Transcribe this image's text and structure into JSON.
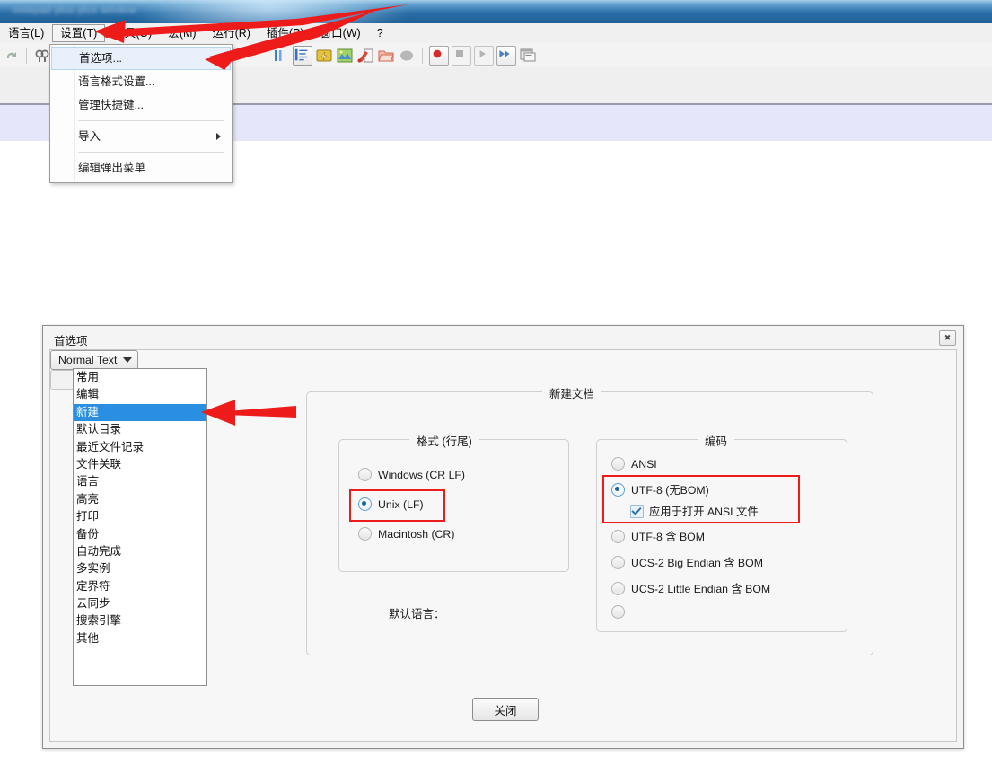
{
  "window": {
    "title_blurred": "notepad plus plus window"
  },
  "menubar": {
    "items": [
      {
        "label": "语言(L)",
        "active": false
      },
      {
        "label": "设置(T)",
        "active": true
      },
      {
        "label": "工具(O)",
        "active": false
      },
      {
        "label": "宏(M)",
        "active": false
      },
      {
        "label": "运行(R)",
        "active": false
      },
      {
        "label": "插件(P)",
        "active": false
      },
      {
        "label": "窗口(W)",
        "active": false
      },
      {
        "label": "?",
        "active": false
      }
    ]
  },
  "toolbar": {
    "icons": [
      {
        "name": "redo-icon",
        "color": "#a9b5ad"
      },
      {
        "name": "find-replace-icon",
        "color": "#8a8a8a"
      },
      {
        "name": "word-wrap-icon",
        "color": "#2f6fd0"
      },
      {
        "name": "show-all-chars-icon",
        "color": "#3b6fc4"
      },
      {
        "name": "indent-guide-icon",
        "color": "#e8c23a"
      },
      {
        "name": "uppercase-map-icon",
        "color": "#7ab648"
      },
      {
        "name": "zoom-tool-icon",
        "color": "#d64a3a"
      },
      {
        "name": "folder-open-icon",
        "color": "#e8836b"
      },
      {
        "name": "macro-stop-icon",
        "color": "#9a9a9a"
      },
      {
        "name": "record-macro-icon",
        "color": "#d42b2b"
      },
      {
        "name": "stop-macro-icon",
        "color": "#9a9a9a"
      },
      {
        "name": "play-macro-icon",
        "color": "#b4b4b4"
      },
      {
        "name": "run-multiple-icon",
        "color": "#4a7ec4"
      },
      {
        "name": "run-dialog-icon",
        "color": "#8e8e8e"
      }
    ]
  },
  "settings_menu": {
    "items": [
      {
        "label": "首选项...",
        "highlighted": true,
        "submenu": false
      },
      {
        "label": "语言格式设置...",
        "highlighted": false,
        "submenu": false
      },
      {
        "label": "管理快捷键...",
        "highlighted": false,
        "submenu": false
      },
      {
        "label": "导入",
        "highlighted": false,
        "submenu": true
      },
      {
        "label": "编辑弹出菜单",
        "highlighted": false,
        "submenu": false
      }
    ]
  },
  "dialog": {
    "title": "首选项",
    "close_icon": "✖",
    "sidebar": {
      "items": [
        {
          "label": "常用",
          "selected": false
        },
        {
          "label": "编辑",
          "selected": false
        },
        {
          "label": "新建",
          "selected": true
        },
        {
          "label": "默认目录",
          "selected": false
        },
        {
          "label": "最近文件记录",
          "selected": false
        },
        {
          "label": "文件关联",
          "selected": false
        },
        {
          "label": "语言",
          "selected": false
        },
        {
          "label": "高亮",
          "selected": false
        },
        {
          "label": "打印",
          "selected": false
        },
        {
          "label": "备份",
          "selected": false
        },
        {
          "label": "自动完成",
          "selected": false
        },
        {
          "label": "多实例",
          "selected": false
        },
        {
          "label": "定界符",
          "selected": false
        },
        {
          "label": "云同步",
          "selected": false
        },
        {
          "label": "搜索引擎",
          "selected": false
        },
        {
          "label": "其他",
          "selected": false
        }
      ]
    },
    "new_document": {
      "legend": "新建文档",
      "format_group": {
        "legend": "格式 (行尾)",
        "options": [
          {
            "label": "Windows (CR LF)",
            "selected": false
          },
          {
            "label": "Unix (LF)",
            "selected": true
          },
          {
            "label": "Macintosh (CR)",
            "selected": false
          }
        ]
      },
      "default_language": {
        "label": "默认语言：",
        "value": "Normal Text"
      },
      "encoding_group": {
        "legend": "编码",
        "options": [
          {
            "label": "ANSI",
            "selected": false
          },
          {
            "label": "UTF-8 (无BOM)",
            "selected": true
          },
          {
            "label": "UTF-8 含 BOM",
            "selected": false
          },
          {
            "label": "UCS-2 Big Endian 含 BOM",
            "selected": false
          },
          {
            "label": "UCS-2 Little Endian 含 BOM",
            "selected": false
          }
        ],
        "apply_ansi_checkbox": {
          "label": "应用于打开 ANSI 文件",
          "checked": true
        },
        "other_encoding_combo": {
          "value": ""
        }
      }
    },
    "close_button": "关闭"
  },
  "annotations": {
    "highlight_color": "#ee1b1b",
    "arrow_count": 3
  }
}
